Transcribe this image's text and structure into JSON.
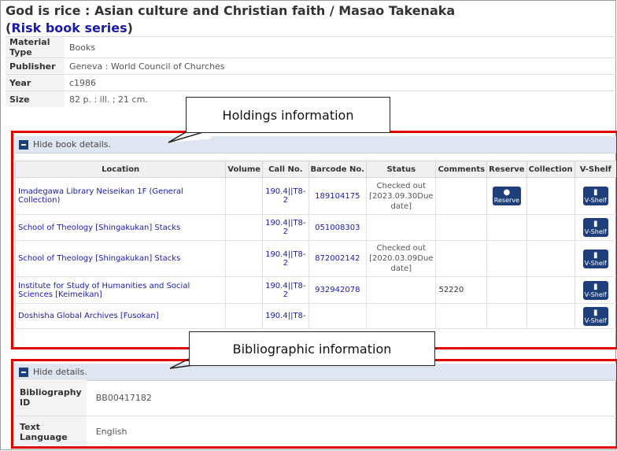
{
  "title": {
    "main": "God is rice : Asian culture and Christian faith / Masao Takenaka",
    "series": "Risk book series"
  },
  "metadata": [
    {
      "key": "Material Type",
      "value": "Books"
    },
    {
      "key": "Publisher",
      "value": "Geneva : World Council of Churches"
    },
    {
      "key": "Year",
      "value": "c1986"
    },
    {
      "key": "Size",
      "value": "82 p. : ill. ; 21 cm."
    }
  ],
  "callouts": {
    "holdings": "Holdings information",
    "bibliographic": "Bibliographic information"
  },
  "holdings": {
    "toggle_label": "Hide book details.",
    "columns": [
      "Location",
      "Volume",
      "Call No.",
      "Barcode No.",
      "Status",
      "Comments",
      "Reserve",
      "Collection",
      "V-Shelf"
    ],
    "rows": [
      {
        "location": "Imadegawa Library Neiseikan 1F (General Collection)",
        "volume": "",
        "call_no": "190.4||T8-2",
        "barcode": "189104175",
        "status": "Checked out [2023.09.30Due date]",
        "comments": "",
        "reserve": "Reserve",
        "vshelf": "V-Shelf"
      },
      {
        "location": "School of Theology [Shingakukan] Stacks",
        "volume": "",
        "call_no": "190.4||T8-2",
        "barcode": "051008303",
        "status": "",
        "comments": "",
        "reserve": "",
        "vshelf": "V-Shelf"
      },
      {
        "location": "School of Theology [Shingakukan] Stacks",
        "volume": "",
        "call_no": "190.4||T8-2",
        "barcode": "872002142",
        "status": "Checked out [2020.03.09Due date]",
        "comments": "",
        "reserve": "",
        "vshelf": "V-Shelf"
      },
      {
        "location": "Institute for Study of Humanities and Social Sciences [Keimeikan]",
        "volume": "",
        "call_no": "190.4||T8-2",
        "barcode": "932942078",
        "status": "",
        "comments": "52220",
        "reserve": "",
        "vshelf": "V-Shelf"
      },
      {
        "location": "Doshisha Global Archives [Fusokan]",
        "volume": "",
        "call_no": "190.4||T8-",
        "barcode": "",
        "status": "",
        "comments": "",
        "reserve": "",
        "vshelf": "V-Shelf"
      }
    ]
  },
  "details": {
    "toggle_label": "Hide details.",
    "rows": [
      {
        "key": "Bibliography ID",
        "value": "BB00417182"
      },
      {
        "key": "Text Language",
        "value": "English"
      }
    ]
  },
  "colors": {
    "accent_red": "#e00000",
    "link_blue": "#1a1aa6",
    "button_navy": "#1e3f7a",
    "header_blue": "#dfe6f1"
  }
}
